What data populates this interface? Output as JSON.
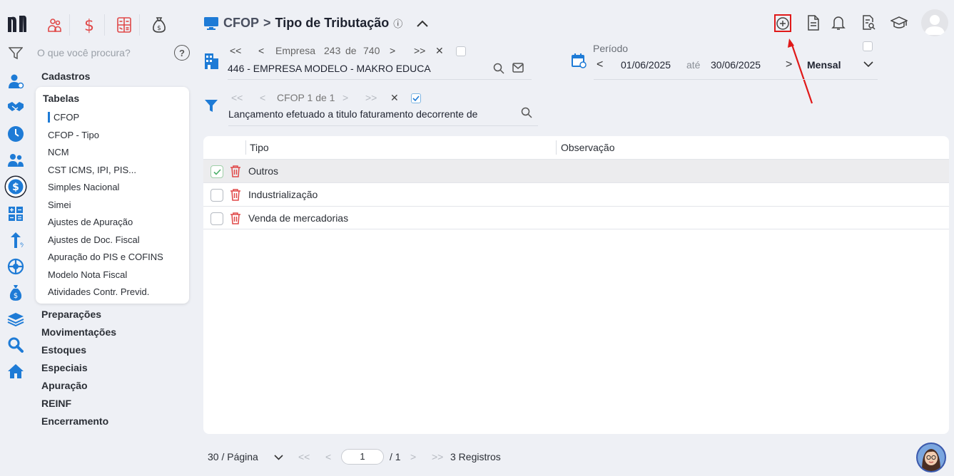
{
  "app": {
    "logo_text": "PI",
    "search_placeholder": "O que você procura?",
    "help_label": "?"
  },
  "sidebar": {
    "menu": [
      "Cadastros",
      "Preparações",
      "Movimentações",
      "Estoques",
      "Especiais",
      "Apuração",
      "REINF",
      "Encerramento"
    ],
    "submenu_title": "Tabelas",
    "submenu_items": [
      "CFOP",
      "CFOP - Tipo",
      "NCM",
      "CST ICMS, IPI, PIS...",
      "Simples Nacional",
      "Simei",
      "Ajustes de Apuração",
      "Ajustes de Doc. Fiscal",
      "Apuração do PIS e COFINS",
      "Modelo Nota Fiscal",
      "Atividades Contr. Previd."
    ],
    "active_item": "CFOP"
  },
  "header": {
    "breadcrumb_parent": "CFOP",
    "breadcrumb_sep": ">",
    "title": "Tipo de Tributação",
    "info_icon": "ⓘ"
  },
  "company": {
    "first": "<<",
    "prev": "<",
    "label": "Empresa",
    "current": "243",
    "of": "de",
    "total": "740",
    "next": ">",
    "last": ">>",
    "clear": "✕",
    "name": "446 - EMPRESA MODELO  - MAKRO EDUCA"
  },
  "period": {
    "label": "Período",
    "prev": "<",
    "start": "01/06/2025",
    "until": "até",
    "end": "30/06/2025",
    "next": ">",
    "type": "Mensal"
  },
  "filter": {
    "first": "<<",
    "prev": "<",
    "label": "CFOP 1 de 1",
    "next": ">",
    "last": ">>",
    "clear": "✕",
    "text": "Lançamento efetuado a titulo faturamento decorrente de"
  },
  "table": {
    "columns": [
      "Tipo",
      "Observação"
    ],
    "rows": [
      {
        "tipo": "Outros",
        "observacao": "",
        "selected": true
      },
      {
        "tipo": "Industrialização",
        "observacao": "",
        "selected": false
      },
      {
        "tipo": "Venda de mercadorias",
        "observacao": "",
        "selected": false
      }
    ]
  },
  "pagination": {
    "per_page": "30 / Página",
    "first": "<<",
    "prev": "<",
    "page": "1",
    "total_pages": "/ 1",
    "next": ">",
    "last": ">>",
    "records": "3 Registros"
  },
  "colors": {
    "accent": "#1e7bd6",
    "danger": "#e04848",
    "highlight_box": "#e01919"
  }
}
